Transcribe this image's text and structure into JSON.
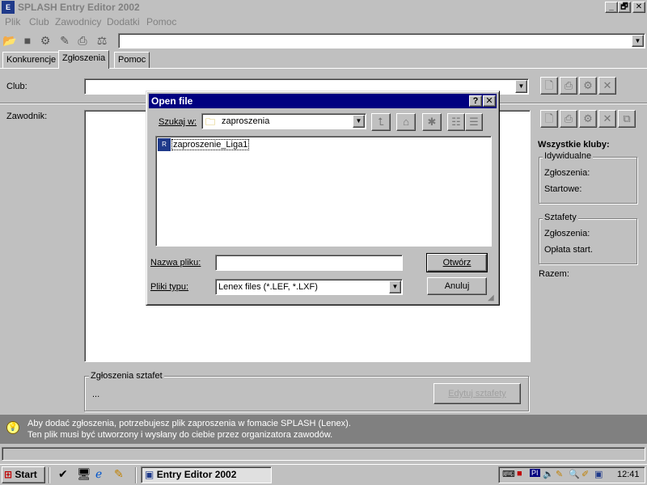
{
  "window": {
    "title": "SPLASH Entry Editor 2002",
    "icon": "E",
    "controls": [
      "_",
      "🗗",
      "✕"
    ]
  },
  "menu": [
    "Plik",
    "Club",
    "Zawodnicy",
    "Dodatki",
    "Pomoc"
  ],
  "toolbar": {
    "icons": [
      "open-folder-icon",
      "stop-icon",
      "tools-icon",
      "wand-icon",
      "printer-icon",
      "filter-icon"
    ],
    "combo_value": ""
  },
  "tabs": [
    {
      "label": "Konkurencje",
      "active": false
    },
    {
      "label": "Zgłoszenia",
      "active": true
    },
    {
      "label": "Pomoc",
      "active": false
    }
  ],
  "club": {
    "label": "Club:",
    "value": ""
  },
  "swimmer": {
    "label": "Zawodnik:"
  },
  "relay": {
    "group_label": "Zgłoszenia sztafet",
    "value": "...",
    "edit_button": "Edytuj sztafety"
  },
  "summary": {
    "title": "Wszystkie kluby:",
    "individual": {
      "label": "Idywidualne",
      "entries": "Zgłoszenia:",
      "fees": "Startowe:"
    },
    "relays": {
      "label": "Sztafety",
      "entries": "Zgłoszenia:",
      "fees": "Opłata start."
    },
    "total": "Razem:"
  },
  "hint": {
    "line1": "Aby dodać zgłoszenia, potrzebujesz plik zaproszenia w fomacie SPLASH (Lenex).",
    "line2": "Ten plik musi być utworzony i wysłany do ciebie przez organizatora zawodów."
  },
  "dialog": {
    "title": "Open file",
    "help": "?",
    "close": "✕",
    "look_in_label": "Szukaj w:",
    "look_in_value": "zaproszenia",
    "files": [
      "zaproszenie_Liga1"
    ],
    "filename_label": "Nazwa pliku:",
    "filename_value": "",
    "filetype_label": "Pliki typu:",
    "filetype_value": "Lenex files (*.LEF, *.LXF)",
    "open_button": "Otwórz",
    "cancel_button": "Anuluj"
  },
  "taskbar": {
    "start": "Start",
    "task": "Entry Editor 2002",
    "clock": "12:41",
    "tray_text": "PI"
  },
  "colors": {
    "titlebar_active": "#000080",
    "desktop_gray": "#c0c0c0",
    "hint_bg": "#808080"
  }
}
